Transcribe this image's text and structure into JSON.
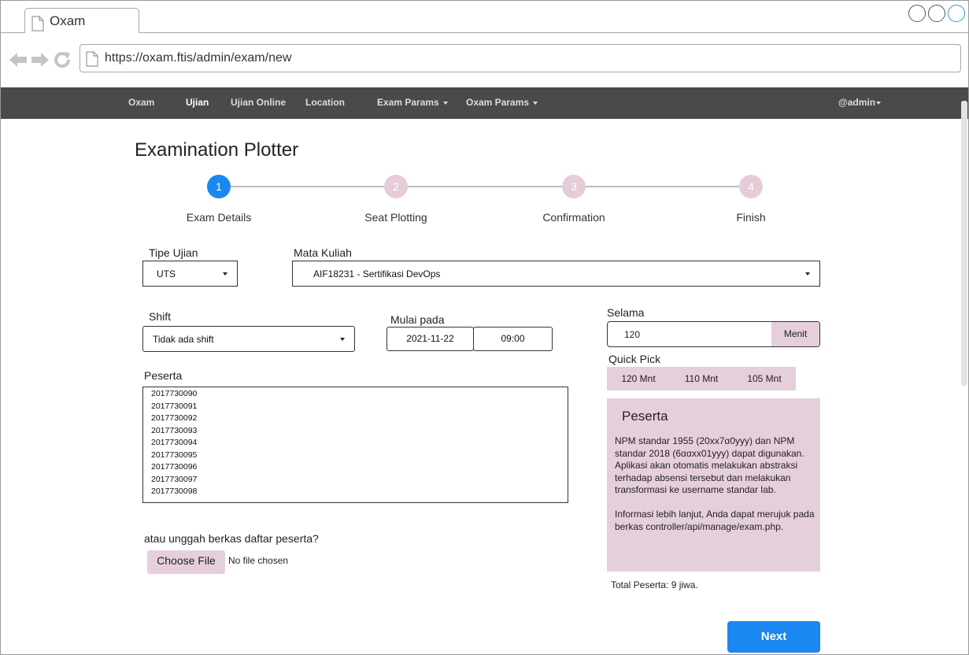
{
  "browser": {
    "tab_title": "Oxam",
    "url": "https://oxam.ftis/admin/exam/new"
  },
  "navbar": {
    "brand": "Oxam",
    "items": [
      {
        "label": "Ujian"
      },
      {
        "label": "Ujian Online"
      },
      {
        "label": "Location"
      },
      {
        "label": "Exam Params"
      },
      {
        "label": "Oxam Params"
      }
    ],
    "user": "@admin"
  },
  "page": {
    "title": "Examination Plotter"
  },
  "stepper": {
    "steps": [
      {
        "number": "1",
        "label": "Exam Details",
        "active": true
      },
      {
        "number": "2",
        "label": "Seat Plotting",
        "active": false
      },
      {
        "number": "3",
        "label": "Confirmation",
        "active": false
      },
      {
        "number": "4",
        "label": "Finish",
        "active": false
      }
    ]
  },
  "form": {
    "tipe_ujian": {
      "label": "Tipe Ujian",
      "value": "UTS"
    },
    "mata_kuliah": {
      "label": "Mata Kuliah",
      "value": "AIF18231 - Sertifikasi DevOps"
    },
    "shift": {
      "label": "Shift",
      "value": "Tidak ada shift"
    },
    "mulai_pada": {
      "label": "Mulai pada",
      "date": "2021-11-22",
      "time": "09:00"
    },
    "selama": {
      "label": "Selama",
      "value": "120",
      "unit": "Menit"
    },
    "quick_pick": {
      "label": "Quick Pick",
      "options": [
        "120 Mnt",
        "110 Mnt",
        "105 Mnt"
      ]
    },
    "peserta": {
      "label": "Peserta",
      "lines": [
        "2017730090",
        "2017730091",
        "2017730092",
        "2017730093",
        "2017730094",
        "2017730095",
        "2017730096",
        "2017730097",
        "2017730098"
      ]
    },
    "upload": {
      "label": "atau unggah berkas daftar peserta?",
      "button": "Choose File",
      "status": "No file chosen"
    }
  },
  "info_panel": {
    "title": "Peserta",
    "paragraph1": "NPM standar 1955 (20xx7α0yyy) dan NPM standar 2018 (6ααxx01yyy) dapat digunakan. Aplikasi akan otomatis melakukan abstraksi terhadap absensi tersebut dan melakukan transformasi ke username standar lab.",
    "paragraph2": "Informasi lebih lanjut, Anda dapat merujuk pada berkas controller/api/manage/exam.php."
  },
  "total": "Total Peserta: 9 jiwa.",
  "actions": {
    "next": "Next"
  },
  "colors": {
    "accent": "#1a88f0",
    "pink": "#e6cfdc",
    "navbar": "#4a4a4a"
  }
}
